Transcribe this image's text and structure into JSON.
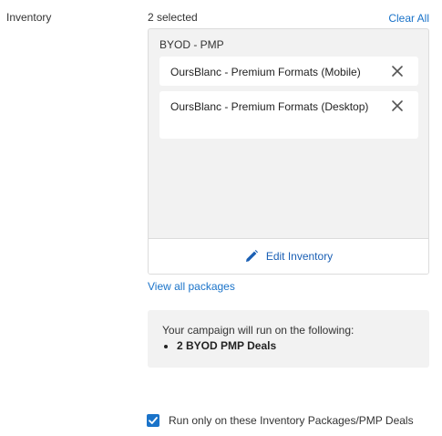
{
  "inventory": {
    "section_label": "Inventory",
    "selected_count": "2 selected",
    "clear_all": "Clear All",
    "group_title": "BYOD - PMP",
    "selected_items": [
      {
        "label": "OursBlanc - Premium Formats (Mobile)"
      },
      {
        "label": "OursBlanc - Premium Formats (Desktop)"
      }
    ],
    "edit_button": "Edit Inventory",
    "view_all_link": "View all packages"
  },
  "summary": {
    "intro": "Your campaign will run on the following:",
    "items": [
      "2 BYOD PMP Deals"
    ]
  },
  "run_only": {
    "label": "Run only on these Inventory Packages/PMP Deals",
    "checked": true
  },
  "colors": {
    "link": "#1a73c9",
    "edit_text": "#1a5fb4",
    "panel_bg": "#f2f2f2",
    "checkbox": "#1a73c9"
  },
  "icons": {
    "remove": "close-icon",
    "edit": "pencil-icon",
    "checkbox": "checkmark-icon"
  }
}
